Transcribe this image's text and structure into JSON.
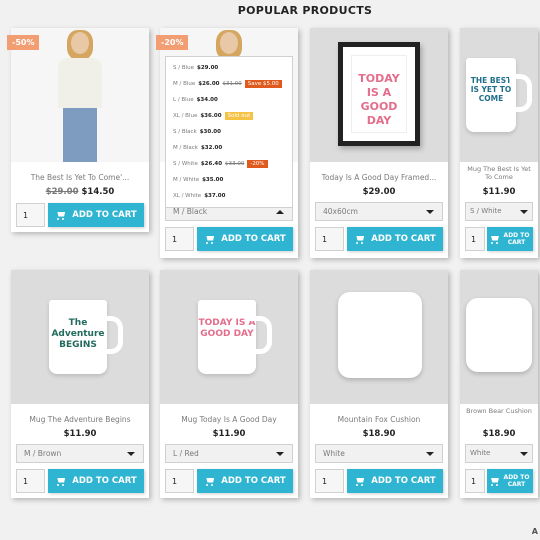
{
  "section_title": "POPULAR PRODUCTS",
  "add_to_cart_label": "ADD TO CART",
  "footer_link": "A",
  "colors": {
    "accent": "#2fb5d2",
    "discount_badge": "#f39d72",
    "save_tag": "#e05a1e",
    "sold_out_tag": "#f5c243"
  },
  "products": [
    {
      "name": "The Best Is Yet To Come'...",
      "old_price": "$29.00",
      "price": "$14.50",
      "badge": "-50%",
      "qty": "1"
    },
    {
      "name": "",
      "badge": "-20%",
      "variant": "M / Black",
      "qty": "1",
      "options": [
        {
          "label": "S / Blue",
          "price": "$29.00"
        },
        {
          "label": "M / Blue",
          "price": "$26.00",
          "old_price": "$31.00",
          "tag": "Save $5.00",
          "tag_type": "save"
        },
        {
          "label": "L / Blue",
          "price": "$34.00"
        },
        {
          "label": "XL / Blue",
          "price": "$36.00",
          "tag": "Sold out",
          "tag_type": "soldout"
        },
        {
          "label": "S / Black",
          "price": "$30.00"
        },
        {
          "label": "M / Black",
          "price": "$32.00"
        },
        {
          "label": "S / White",
          "price": "$26.40",
          "old_price": "$33.00",
          "tag": "-20%",
          "tag_type": "save"
        },
        {
          "label": "M / White",
          "price": "$35.00"
        },
        {
          "label": "XL / White",
          "price": "$37.00"
        }
      ]
    },
    {
      "name": "Today Is A Good Day Framed...",
      "price": "$29.00",
      "variant": "40x60cm",
      "qty": "1",
      "art": "TODAY IS A GOOD DAY"
    },
    {
      "name": "Mug The Best Is Yet To Come",
      "price": "$11.90",
      "variant": "S / White",
      "qty": "1",
      "art": "THE BEST IS YET TO COME"
    },
    {
      "name": "Mug The Adventure Begins",
      "price": "$11.90",
      "variant": "M / Brown",
      "qty": "1",
      "art": "The Adventure BEGINS"
    },
    {
      "name": "Mug Today Is A Good Day",
      "price": "$11.90",
      "variant": "L / Red",
      "qty": "1",
      "art": "TODAY IS A GOOD DAY"
    },
    {
      "name": "Mountain Fox Cushion",
      "price": "$18.90",
      "variant": "White",
      "qty": "1"
    },
    {
      "name": "Brown Bear Cushion",
      "price": "$18.90",
      "variant": "White",
      "qty": "1"
    }
  ]
}
